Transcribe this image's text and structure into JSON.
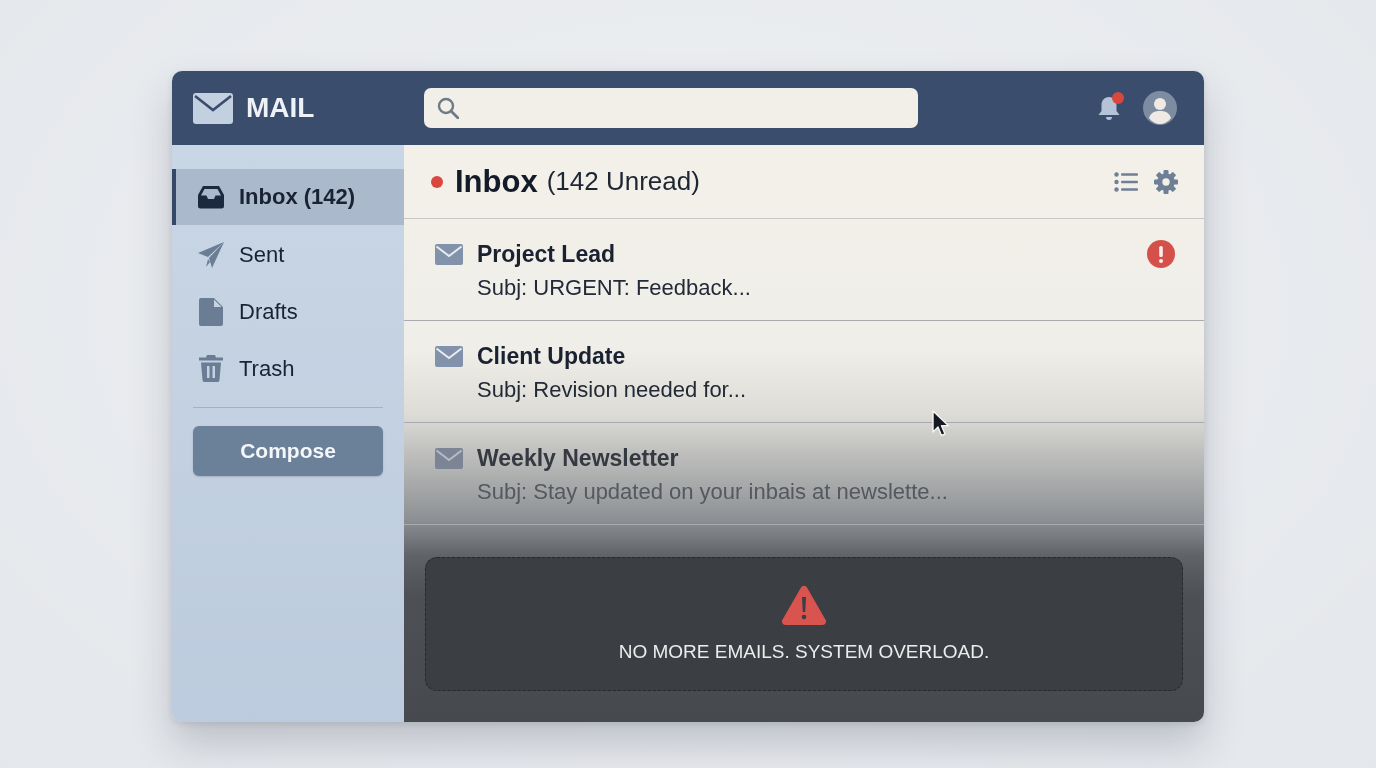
{
  "app": {
    "title": "MAIL"
  },
  "header": {
    "notification_dot": true
  },
  "sidebar": {
    "items": [
      {
        "label": "Inbox (142)",
        "selected": true
      },
      {
        "label": "Sent",
        "selected": false
      },
      {
        "label": "Drafts",
        "selected": false
      },
      {
        "label": "Trash",
        "selected": false
      }
    ],
    "compose_button": "Compose"
  },
  "mailbox": {
    "title": "Inbox",
    "count": "(142 Unread)",
    "unread_dot": true
  },
  "messages": [
    {
      "sender": "Project Lead",
      "subject": "Subj: URGENT: Feedback...",
      "urgent": true,
      "dimmed": false
    },
    {
      "sender": "Client Update",
      "subject": "Subj: Revision needed for...",
      "urgent": false,
      "dimmed": false
    },
    {
      "sender": "Weekly Newsletter",
      "subject": "Subj: Stay updated on your inbais at newslette...",
      "urgent": false,
      "dimmed": true
    }
  ],
  "overload_notice": {
    "message": "NO MORE EMAILS. SYSTEM OVERLOAD."
  }
}
